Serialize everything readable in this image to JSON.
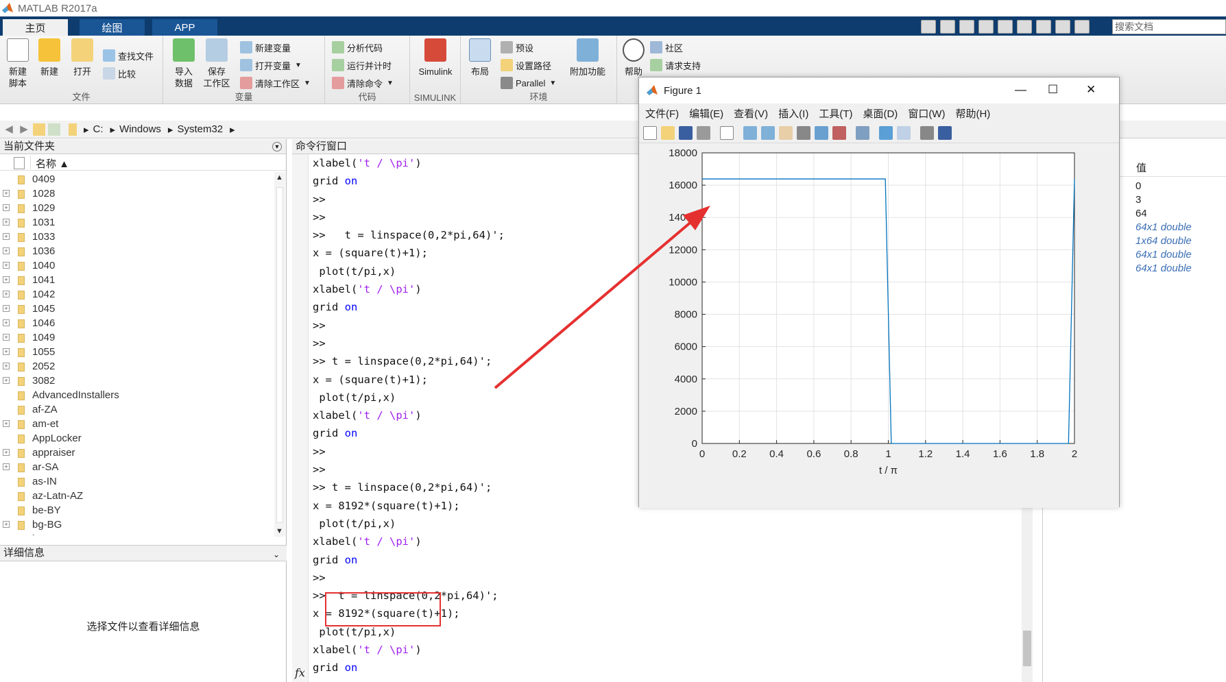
{
  "app": {
    "title": "MATLAB R2017a"
  },
  "tabs": [
    "主页",
    "绘图",
    "APP"
  ],
  "search": {
    "placeholder": "搜索文档"
  },
  "ribbon": {
    "file": {
      "label": "文件",
      "new_script": "新建\n脚本",
      "new": "新建",
      "open": "打开",
      "find_files": "查找文件",
      "compare": "比较"
    },
    "variable": {
      "label": "变量",
      "import": "导入\n数据",
      "save": "保存\n工作区",
      "new_var": "新建变量",
      "open_var": "打开变量",
      "clear_ws": "清除工作区"
    },
    "code": {
      "label": "代码",
      "analyze": "分析代码",
      "run_time": "运行并计时",
      "clear_cmd": "清除命令"
    },
    "simulink": {
      "label": "SIMULINK",
      "simulink": "Simulink"
    },
    "env": {
      "label": "环境",
      "layout": "布局",
      "prefs": "预设",
      "set_path": "设置路径",
      "parallel": "Parallel",
      "addons": "附加功能"
    },
    "help": {
      "help": "帮助",
      "community": "社区",
      "request_support": "请求支持"
    }
  },
  "address": {
    "parts": [
      "C:",
      "Windows",
      "System32"
    ]
  },
  "current_folder": {
    "title": "当前文件夹",
    "col_name": "名称 ▲",
    "items": [
      "0409",
      "1028",
      "1029",
      "1031",
      "1033",
      "1036",
      "1040",
      "1041",
      "1042",
      "1045",
      "1046",
      "1049",
      "1055",
      "2052",
      "3082",
      "AdvancedInstallers",
      "af-ZA",
      "am-et",
      "AppLocker",
      "appraiser",
      "ar-SA",
      "as-IN",
      "az-Latn-AZ",
      "be-BY",
      "bg-BG",
      "bn-BD"
    ]
  },
  "details": {
    "title": "详细信息",
    "message": "选择文件以查看详细信息"
  },
  "command_window": {
    "title": "命令行窗口",
    "fx": "fx",
    "lines": [
      "xlabel('t / \\pi')",
      "grid on",
      ">>",
      ">>",
      ">>   t = linspace(0,2*pi,64)';",
      "x = (square(t)+1);",
      " plot(t/pi,x)",
      "xlabel('t / \\pi')",
      "grid on",
      ">>",
      ">>",
      ">> t = linspace(0,2*pi,64)';",
      "x = (square(t)+1);",
      " plot(t/pi,x)",
      "xlabel('t / \\pi')",
      "grid on",
      ">>",
      ">>",
      ">> t = linspace(0,2*pi,64)';",
      "x = 8192*(square(t)+1);",
      " plot(t/pi,x)",
      "xlabel('t / \\pi')",
      "grid on",
      ">>",
      ">>  t = linspace(0,2*pi,64)';",
      "x = 8192*(square(t)+1);",
      " plot(t/pi,x)",
      "xlabel('t / \\pi')",
      "grid on",
      ">>"
    ]
  },
  "workspace": {
    "col_value": "值",
    "values": [
      "0",
      "3",
      "64",
      "64x1 double",
      "1x64 double",
      "64x1 double",
      "64x1 double"
    ]
  },
  "figure": {
    "title": "Figure 1",
    "menu": [
      "文件(F)",
      "编辑(E)",
      "查看(V)",
      "插入(I)",
      "工具(T)",
      "桌面(D)",
      "窗口(W)",
      "帮助(H)"
    ]
  },
  "colors": {
    "tab_bar": "#0e3c6e",
    "line": "#0072bd",
    "keyword": "#0000ff",
    "string": "#a020f0",
    "annotation": "#e53030"
  },
  "chart_data": {
    "type": "line",
    "xlabel": "t / π",
    "ylabel": "",
    "title": "",
    "xlim": [
      0,
      2
    ],
    "ylim": [
      0,
      18000
    ],
    "xticks": [
      "0",
      "0.2",
      "0.4",
      "0.6",
      "0.8",
      "1",
      "1.2",
      "1.4",
      "1.6",
      "1.8",
      "2"
    ],
    "yticks": [
      "0",
      "2000",
      "4000",
      "6000",
      "8000",
      "10000",
      "12000",
      "14000",
      "16000",
      "18000"
    ],
    "grid": true,
    "series": [
      {
        "x": [
          0,
          0.984,
          1.016,
          1.968,
          2
        ],
        "y": [
          16384,
          16384,
          0,
          0,
          16384
        ]
      }
    ]
  }
}
